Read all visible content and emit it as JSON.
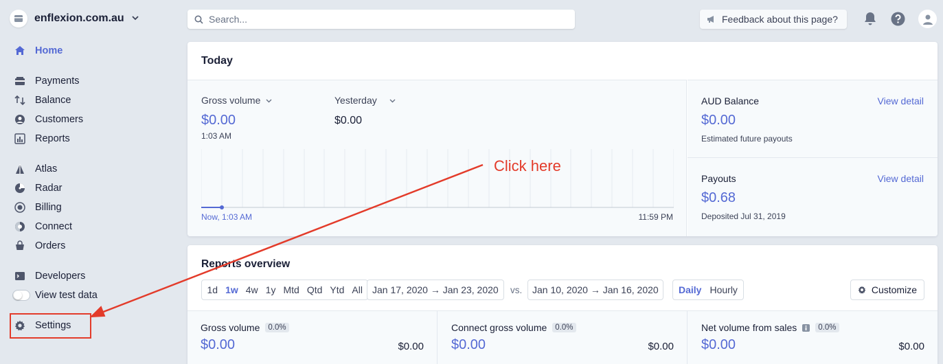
{
  "account": {
    "name": "enflexion.com.au"
  },
  "search": {
    "placeholder": "Search..."
  },
  "feedback": {
    "label": "Feedback about this page?"
  },
  "nav": {
    "home": "Home",
    "payments": "Payments",
    "balance": "Balance",
    "customers": "Customers",
    "reports": "Reports",
    "atlas": "Atlas",
    "radar": "Radar",
    "billing": "Billing",
    "connect": "Connect",
    "orders": "Orders",
    "developers": "Developers",
    "view_test_data": "View test data",
    "settings": "Settings"
  },
  "today": {
    "title": "Today",
    "gross_volume_label": "Gross volume",
    "gross_volume_value": "$0.00",
    "gross_volume_time": "1:03 AM",
    "yesterday_label": "Yesterday",
    "yesterday_value": "$0.00",
    "chart_start_label": "Now, 1:03 AM",
    "chart_end_label": "11:59 PM",
    "balance_label": "AUD Balance",
    "balance_value": "$0.00",
    "balance_sub": "Estimated future payouts",
    "payouts_label": "Payouts",
    "payouts_value": "$0.68",
    "payouts_sub": "Deposited Jul 31, 2019",
    "view_detail": "View detail"
  },
  "annotation": {
    "text": "Click here"
  },
  "reports": {
    "title": "Reports overview",
    "ranges": [
      "1d",
      "1w",
      "4w",
      "1y",
      "Mtd",
      "Qtd",
      "Ytd",
      "All"
    ],
    "active_range": "1w",
    "date_range": "Jan 17, 2020 → Jan 23, 2020",
    "vs": "vs.",
    "compare_range": "Jan 10, 2020 → Jan 16, 2020",
    "granularity_daily": "Daily",
    "granularity_hourly": "Hourly",
    "customize": "Customize",
    "metrics": [
      {
        "label": "Gross volume",
        "change": "0.0%",
        "value": "$0.00",
        "compare": "$0.00"
      },
      {
        "label": "Connect gross volume",
        "change": "0.0%",
        "value": "$0.00",
        "compare": "$0.00"
      },
      {
        "label": "Net volume from sales",
        "change": "0.0%",
        "value": "$0.00",
        "compare": "$0.00"
      }
    ]
  },
  "colors": {
    "accent": "#5469d4",
    "annotation": "#e33b2a",
    "background": "#e3e8ee"
  }
}
